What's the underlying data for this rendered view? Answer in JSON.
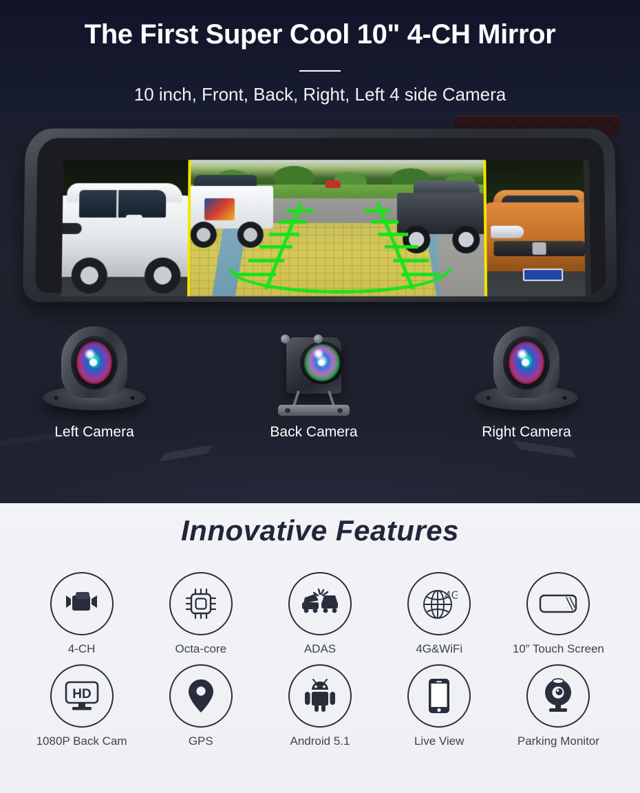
{
  "hero": {
    "title": "The First Super Cool 10\" 4-CH Mirror",
    "subtitle": "10 inch, Front, Back, Right, Left 4 side Camera"
  },
  "mirror": {
    "panes": [
      {
        "name": "left-camera-view",
        "label": "Left side camera view"
      },
      {
        "name": "rear-camera-view",
        "label": "Rear camera view with parking guidelines"
      },
      {
        "name": "right-camera-view",
        "label": "Right side camera view"
      }
    ],
    "divider_color": "#f5e400",
    "guideline_color": "#19e219"
  },
  "cameras": [
    {
      "name": "left-camera",
      "label": "Left Camera",
      "type": "dome"
    },
    {
      "name": "back-camera",
      "label": "Back Camera",
      "type": "box"
    },
    {
      "name": "right-camera",
      "label": "Right Camera",
      "type": "dome"
    }
  ],
  "features": {
    "title": "Innovative Features",
    "items": [
      {
        "label": "4-CH",
        "icon": "video-camera-icon"
      },
      {
        "label": "Octa-core",
        "icon": "cpu-chip-icon"
      },
      {
        "label": "ADAS",
        "icon": "car-collision-icon"
      },
      {
        "label": "4G&WiFi",
        "icon": "globe-4g-icon"
      },
      {
        "label": "10” Touch Screen",
        "icon": "touch-screen-icon"
      },
      {
        "label": "1080P Back Cam",
        "icon": "hd-monitor-icon"
      },
      {
        "label": "GPS",
        "icon": "map-pin-icon"
      },
      {
        "label": "Android 5.1",
        "icon": "android-robot-icon"
      },
      {
        "label": "Live View",
        "icon": "smartphone-icon"
      },
      {
        "label": "Parking Monitor",
        "icon": "webcam-icon"
      }
    ],
    "badge_4g": "4G",
    "hd_text": "HD"
  },
  "colors": {
    "hero_bg": "#14162a",
    "features_bg": "#f0f1f5",
    "title_text": "#ffffff",
    "feature_title_text": "#23263a",
    "icon_stroke": "#2a2d3c",
    "divider": "#ffffff"
  }
}
